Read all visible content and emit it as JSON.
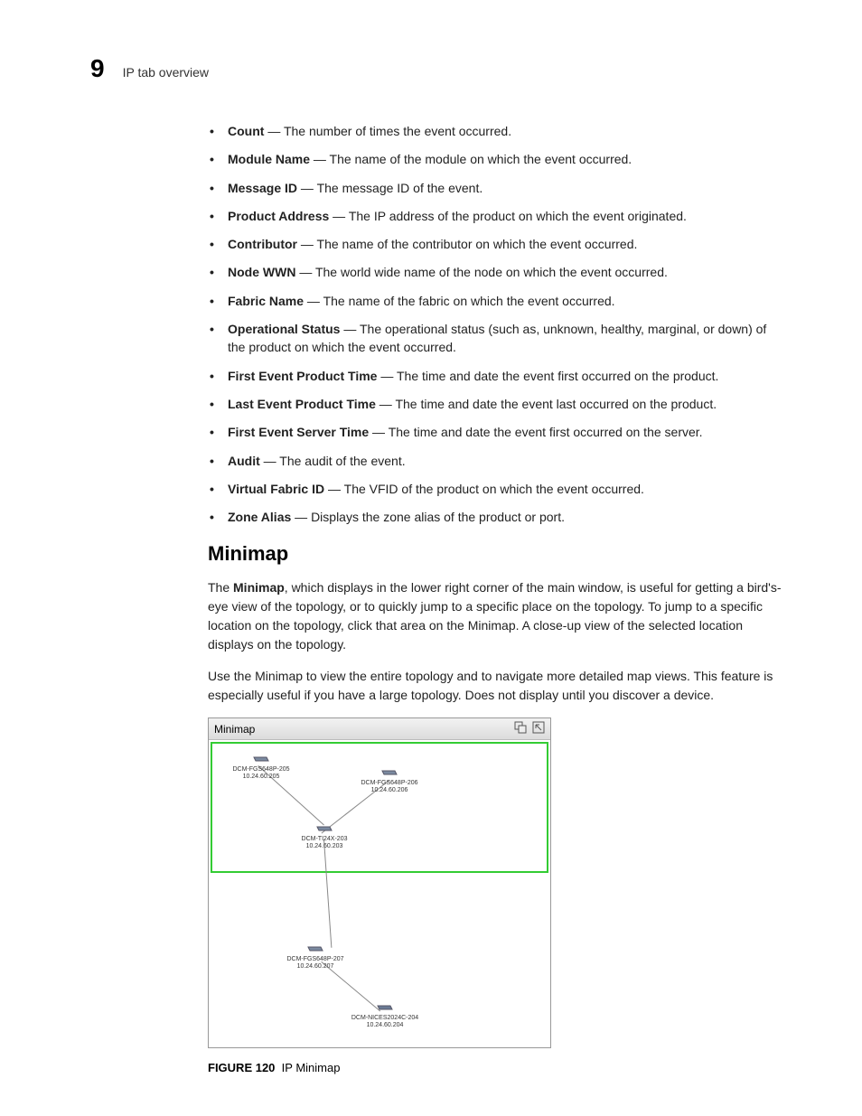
{
  "header": {
    "chapter": "9",
    "title": "IP tab overview"
  },
  "definitions": [
    {
      "term": "Count",
      "desc": "The number of times the event occurred."
    },
    {
      "term": "Module Name",
      "desc": "The name of the module on which the event occurred."
    },
    {
      "term": "Message ID",
      "desc": "The message ID of the event."
    },
    {
      "term": "Product Address",
      "desc": "The IP address of the product on which the event originated."
    },
    {
      "term": "Contributor",
      "desc": "The name of the contributor on which the event occurred."
    },
    {
      "term": "Node WWN",
      "desc": "The world wide name of the node on which the event occurred."
    },
    {
      "term": "Fabric Name",
      "desc": "The name of the fabric on which the event occurred."
    },
    {
      "term": "Operational Status",
      "desc": "The operational status (such as, unknown, healthy, marginal, or down) of the product on which the event occurred."
    },
    {
      "term": "First Event Product Time",
      "desc": "The time and date the event first occurred on the product."
    },
    {
      "term": "Last Event Product Time",
      "desc": "The time and date the event last occurred on the product."
    },
    {
      "term": "First Event Server Time",
      "desc": "The time and date the event first occurred on the server."
    },
    {
      "term": "Audit",
      "desc": "The audit of the event."
    },
    {
      "term": "Virtual Fabric ID",
      "desc": "The VFID of the product on which the event occurred."
    },
    {
      "term": "Zone Alias",
      "desc": "Displays the zone alias of the product or port."
    }
  ],
  "section": {
    "heading": "Minimap",
    "para1_lead": "Minimap",
    "para1_pre": "The ",
    "para1_rest": ", which displays in the lower right corner of the main window, is useful for getting a bird's-eye view of the topology, or to quickly jump to a specific place on the topology. To jump to a specific location on the topology, click that area on the Minimap. A close-up view of the selected location displays on the topology.",
    "para2": "Use the Minimap to view the entire topology and to navigate more detailed map views. This feature is especially useful if you have a large topology. Does not display until you discover a device."
  },
  "minimap": {
    "title": "Minimap",
    "nodes": [
      {
        "name": "DCM-FGS648P-205",
        "ip": "10.24.60.205"
      },
      {
        "name": "DCM-FGS648P-206",
        "ip": "10.24.60.206"
      },
      {
        "name": "DCM-TI24X-203",
        "ip": "10.24.60.203"
      },
      {
        "name": "DCM-FGS648P-207",
        "ip": "10.24.60.207"
      },
      {
        "name": "DCM-NICES2024C-204",
        "ip": "10.24.60.204"
      }
    ]
  },
  "figure": {
    "label": "FIGURE 120",
    "caption": "IP Minimap"
  }
}
